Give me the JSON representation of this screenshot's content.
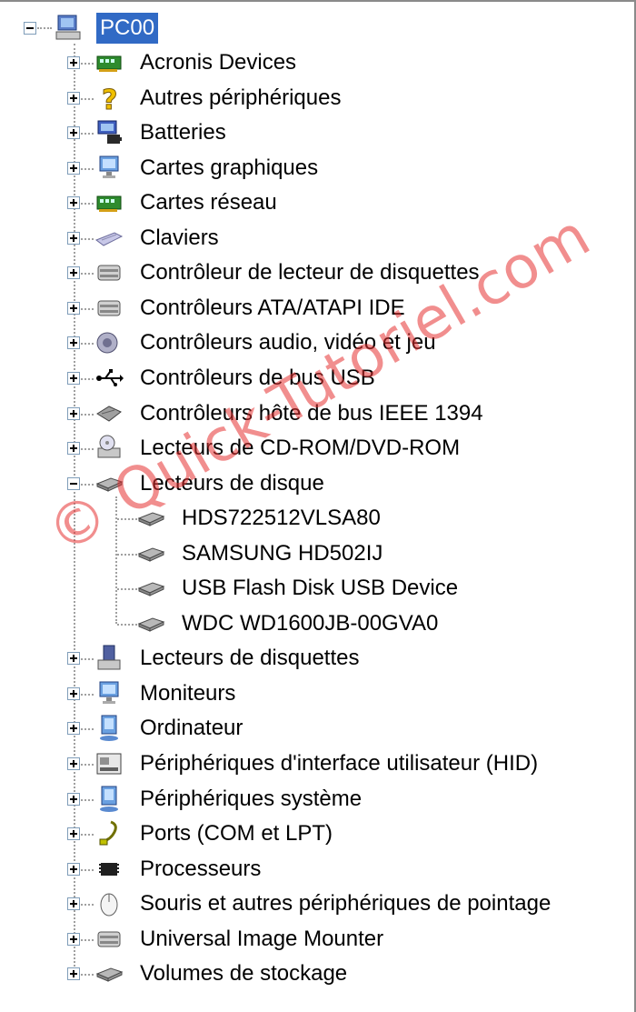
{
  "root": {
    "label": "PC00"
  },
  "categories": [
    {
      "label": "Acronis Devices",
      "icon": "network-card-icon"
    },
    {
      "label": "Autres périphériques",
      "icon": "question-mark-icon"
    },
    {
      "label": "Batteries",
      "icon": "battery-computer-icon"
    },
    {
      "label": "Cartes graphiques",
      "icon": "monitor-icon"
    },
    {
      "label": "Cartes réseau",
      "icon": "network-card-icon"
    },
    {
      "label": "Claviers",
      "icon": "keyboard-icon"
    },
    {
      "label": "Contrôleur de lecteur de disquettes",
      "icon": "controller-icon"
    },
    {
      "label": "Contrôleurs ATA/ATAPI IDE",
      "icon": "controller-icon"
    },
    {
      "label": "Contrôleurs audio, vidéo et jeu",
      "icon": "speaker-icon"
    },
    {
      "label": "Contrôleurs de bus USB",
      "icon": "usb-icon"
    },
    {
      "label": "Contrôleurs hôte de bus IEEE 1394",
      "icon": "ieee1394-icon"
    },
    {
      "label": "Lecteurs de CD-ROM/DVD-ROM",
      "icon": "cdrom-icon"
    },
    {
      "label": "Lecteurs de disque",
      "icon": "disk-drive-icon",
      "expanded": true,
      "children": [
        "HDS722512VLSA80",
        "SAMSUNG HD502IJ",
        "USB Flash Disk USB Device",
        "WDC WD1600JB-00GVA0"
      ]
    },
    {
      "label": "Lecteurs de disquettes",
      "icon": "floppy-icon"
    },
    {
      "label": "Moniteurs",
      "icon": "monitor-icon"
    },
    {
      "label": "Ordinateur",
      "icon": "computer-icon"
    },
    {
      "label": "Périphériques d'interface utilisateur (HID)",
      "icon": "hid-icon"
    },
    {
      "label": "Périphériques système",
      "icon": "computer-icon"
    },
    {
      "label": "Ports (COM et LPT)",
      "icon": "port-icon"
    },
    {
      "label": "Processeurs",
      "icon": "processor-icon"
    },
    {
      "label": "Souris et autres périphériques de pointage",
      "icon": "mouse-icon"
    },
    {
      "label": "Universal Image Mounter",
      "icon": "controller-icon"
    },
    {
      "label": "Volumes de stockage",
      "icon": "disk-drive-icon"
    }
  ],
  "watermark": "© Quick-Tutoriel.com"
}
